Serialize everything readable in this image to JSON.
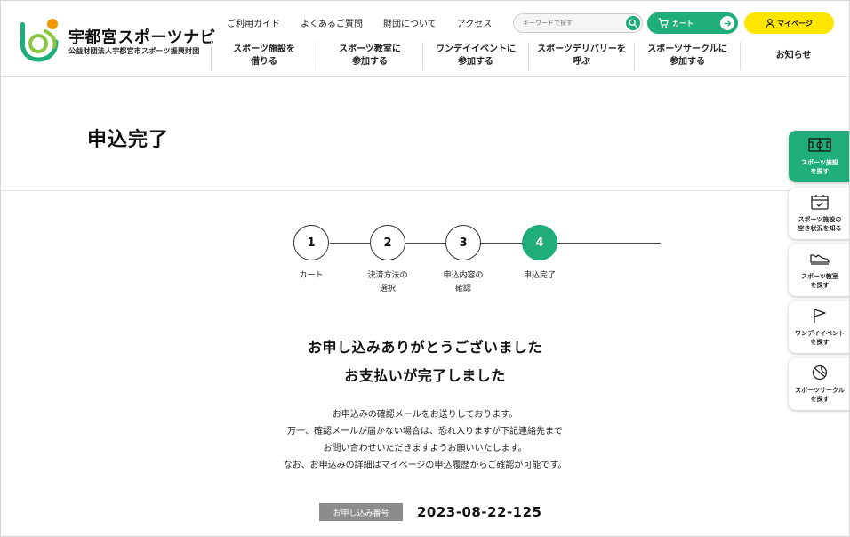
{
  "brand": {
    "title": "宇都宮スポーツナビ",
    "subtitle": "公益財団法人宇都宮市スポーツ振興財団",
    "colors": {
      "green": "#1fae7a",
      "yellow": "#ffe600",
      "orange": "#f39800"
    }
  },
  "header": {
    "util_links": [
      "ご利用ガイド",
      "よくあるご質問",
      "財団について",
      "アクセス"
    ],
    "search": {
      "placeholder": "キーワードで探す",
      "icon": "search-icon"
    },
    "cart_label": "カート",
    "mypage_label": "マイページ",
    "nav": [
      "スポーツ施設を\n借りる",
      "スポーツ教室に\n参加する",
      "ワンデイイベントに\n参加する",
      "スポーツデリバリーを\n呼ぶ",
      "スポーツサークルに\n参加する",
      "お知らせ"
    ]
  },
  "page": {
    "title": "申込完了"
  },
  "steps": [
    {
      "number": "1",
      "label": "カート",
      "active": false
    },
    {
      "number": "2",
      "label": "決済方法の\n選択",
      "active": false
    },
    {
      "number": "3",
      "label": "申込内容の\n確認",
      "active": false
    },
    {
      "number": "4",
      "label": "申込完了",
      "active": true
    }
  ],
  "message": {
    "headline_1": "お申し込みありがとうございました",
    "headline_2": "お支払いが完了しました",
    "body": [
      "お申込みの確認メールをお送りしております。",
      "万一、確認メールが届かない場合は、恐れ入りますが下記連絡先まで",
      "お問い合わせいただきますようお願いいたします。",
      "なお、お申込みの詳細はマイページの申込履歴からご確認が可能です。"
    ]
  },
  "application": {
    "label": "お申し込み番号",
    "number": "2023-08-22-125"
  },
  "side_nav": [
    {
      "label": "スポーツ施設\nを探す",
      "icon": "court-icon",
      "active": true
    },
    {
      "label": "スポーツ施設の\n空き状況を知る",
      "icon": "calendar-icon",
      "active": false
    },
    {
      "label": "スポーツ教室\nを探す",
      "icon": "shoe-icon",
      "active": false
    },
    {
      "label": "ワンデイイベント\nを探す",
      "icon": "flag-icon",
      "active": false
    },
    {
      "label": "スポーツサークル\nを探す",
      "icon": "ball-icon",
      "active": false
    }
  ]
}
